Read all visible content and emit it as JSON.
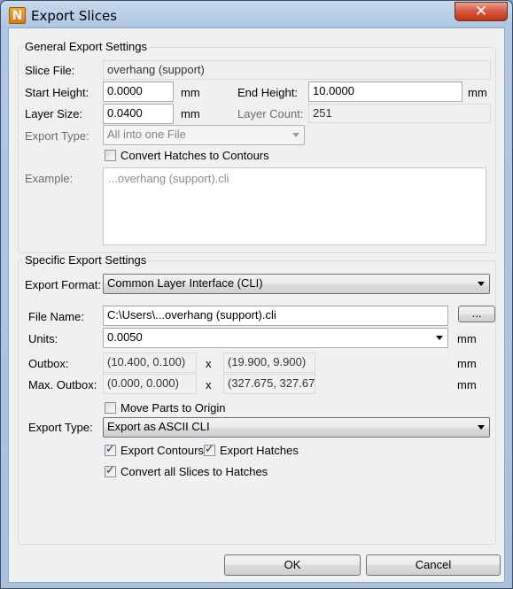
{
  "window": {
    "title": "Export Slices",
    "close_glyph": "✕",
    "app_icon_letter": "N"
  },
  "general": {
    "group_label": "General Export Settings",
    "slice_file_label": "Slice File:",
    "slice_file_value": "overhang (support)",
    "start_height_label": "Start Height:",
    "start_height_value": "0.0000",
    "start_height_unit": "mm",
    "end_height_label": "End Height:",
    "end_height_value": "10.0000",
    "end_height_unit": "mm",
    "layer_size_label": "Layer Size:",
    "layer_size_value": "0.0400",
    "layer_size_unit": "mm",
    "layer_count_label": "Layer Count:",
    "layer_count_value": "251",
    "export_type_label": "Export Type:",
    "export_type_value": "All into one File",
    "convert_hatches_label": "Convert Hatches to Contours",
    "convert_hatches_checked": false,
    "example_label": "Example:",
    "example_value": "...overhang (support).cli"
  },
  "specific": {
    "group_label": "Specific Export Settings",
    "export_format_label": "Export Format:",
    "export_format_value": "Common Layer Interface (CLI)",
    "file_name_label": "File Name:",
    "file_name_value": "C:\\Users\\...overhang (support).cli",
    "browse_label": "...",
    "units_label": "Units:",
    "units_value": "0.0050",
    "units_unit": "mm",
    "outbox_label": "Outbox:",
    "outbox_min": "(10.400, 0.100)",
    "outbox_x": "x",
    "outbox_max": "(19.900, 9.900)",
    "outbox_unit": "mm",
    "max_outbox_label": "Max. Outbox:",
    "max_outbox_min": "(0.000, 0.000)",
    "max_outbox_x": "x",
    "max_outbox_max": "(327.675, 327.67",
    "max_outbox_unit": "mm",
    "move_parts_label": "Move Parts to Origin",
    "move_parts_checked": false,
    "export_type_label": "Export Type:",
    "export_type_value": "Export as ASCII CLI",
    "export_contours_label": "Export Contours",
    "export_contours_checked": true,
    "export_hatches_label": "Export Hatches",
    "export_hatches_checked": true,
    "convert_slices_label": "Convert all Slices to Hatches",
    "convert_slices_checked": true
  },
  "footer": {
    "ok_label": "OK",
    "cancel_label": "Cancel"
  }
}
